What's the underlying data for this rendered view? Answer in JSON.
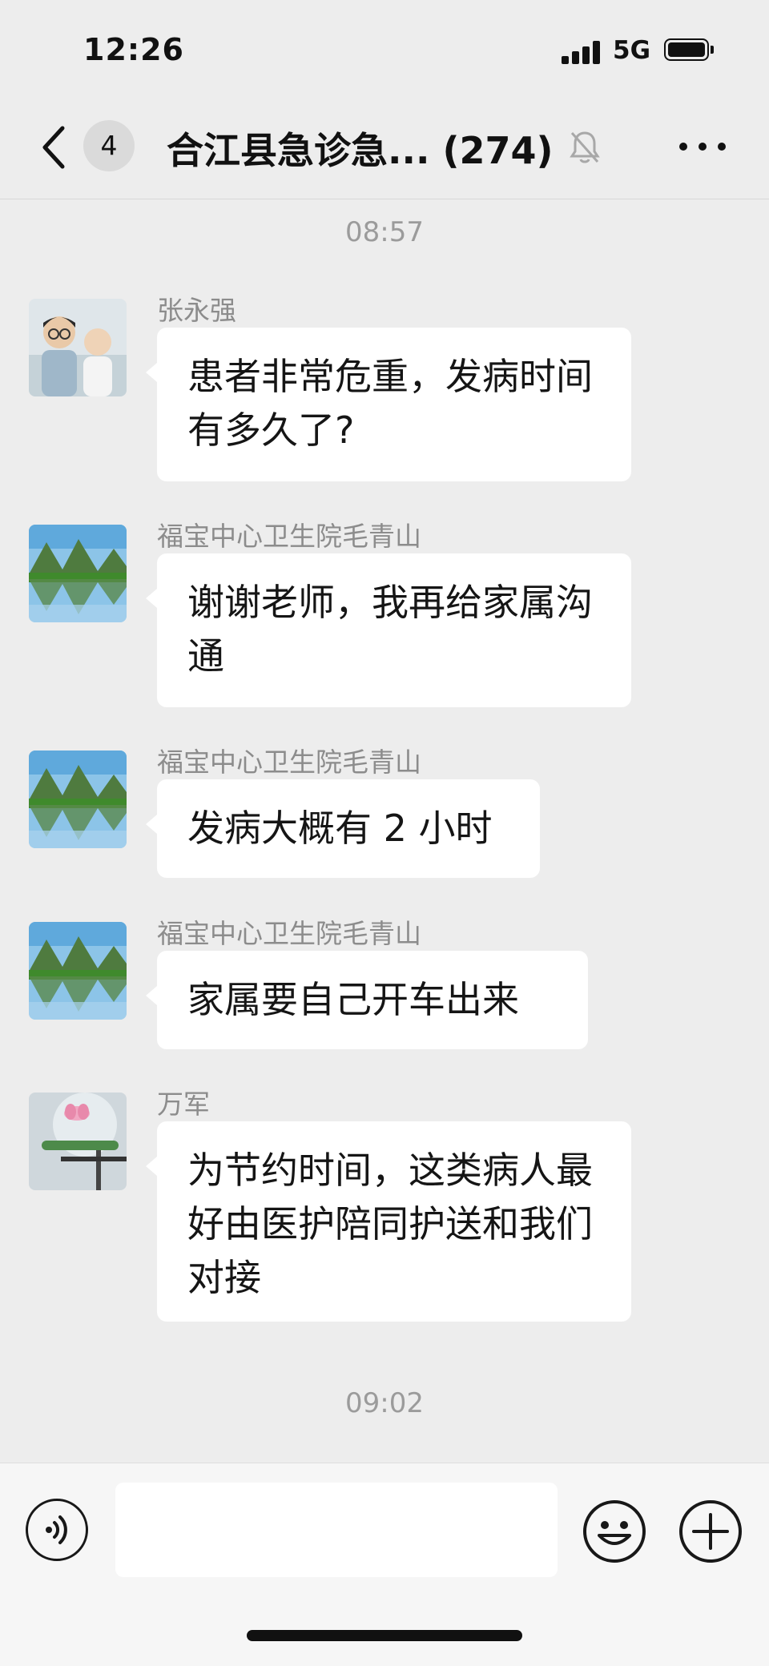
{
  "status_bar": {
    "time": "12:26",
    "network": "5G",
    "battery_icon": "battery-full-icon",
    "signal_icon": "cellular-signal-icon"
  },
  "nav": {
    "back_icon": "chevron-left-icon",
    "unread_count": "4",
    "title": "合江县急诊急... (274)",
    "mute_icon": "bell-muted-icon",
    "more_icon": "ellipsis-icon"
  },
  "messages": [
    {
      "timestamp": "08:57"
    },
    {
      "sender": "张永强",
      "text": "患者非常危重，发病时间有多久了?"
    },
    {
      "sender": "福宝中心卫生院毛青山",
      "text": "谢谢老师，我再给家属沟通"
    },
    {
      "sender": "福宝中心卫生院毛青山",
      "text": "发病大概有 2 小时"
    },
    {
      "sender": "福宝中心卫生院毛青山",
      "text": "家属要自己开车出来"
    },
    {
      "sender": "万军",
      "text": "为节约时间，这类病人最好由医护陪同护送和我们对接"
    },
    {
      "timestamp": "09:02"
    }
  ],
  "input_bar": {
    "voice_icon": "voice-input-icon",
    "input_value": "",
    "emoji_icon": "emoji-icon",
    "plus_icon": "plus-circle-icon"
  },
  "colors": {
    "background": "#ededed",
    "bubble": "#ffffff",
    "meta_text": "#9b9b9b"
  }
}
